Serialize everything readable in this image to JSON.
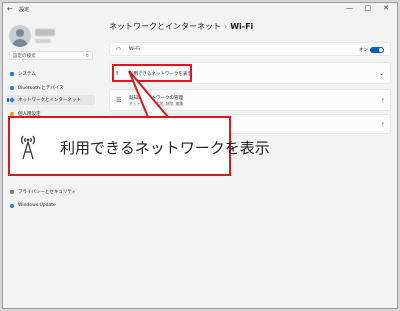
{
  "window": {
    "back_glyph": "←",
    "title": "設定",
    "minimize_glyph": "—",
    "maximize_glyph": "□",
    "close_glyph": "✕"
  },
  "sidebar": {
    "search_placeholder": "設定の検索",
    "items": [
      {
        "label": "システム",
        "icon": "monitor-icon",
        "color": "#2b7cd3"
      },
      {
        "label": "Bluetooth とデバイス",
        "icon": "bluetooth-icon",
        "color": "#2b7cd3"
      },
      {
        "label": "ネットワークとインターネット",
        "icon": "network-icon",
        "color": "#2b7cd3",
        "active": true
      },
      {
        "label": "個人用設定",
        "icon": "brush-icon",
        "color": "#e8a33d"
      },
      {
        "label": "プライバシーとセキュリティ",
        "icon": "shield-icon",
        "color": "#7a7a7a"
      },
      {
        "label": "Windows Update",
        "icon": "update-icon",
        "color": "#2b7cd3"
      }
    ],
    "partial_item": "アプリ"
  },
  "main": {
    "breadcrumb_parent": "ネットワークとインターネット",
    "breadcrumb_sep": "›",
    "breadcrumb_current": "Wi-Fi",
    "wifi_row": {
      "label": "Wi-Fi",
      "toggle_label": "オン",
      "toggle_on": true
    },
    "available_networks": {
      "label": "利用できるネットワークを表示"
    },
    "manage_networks": {
      "label": "既知のネットワークの管理",
      "sub": "ネットワークの追加, 削除, 編集"
    },
    "fourth_row": {
      "label": ""
    }
  },
  "callout": {
    "text": "利用できるネットワークを表示",
    "icon": "antenna-icon"
  },
  "colors": {
    "highlight": "#d91920",
    "accent": "#005fb8"
  }
}
